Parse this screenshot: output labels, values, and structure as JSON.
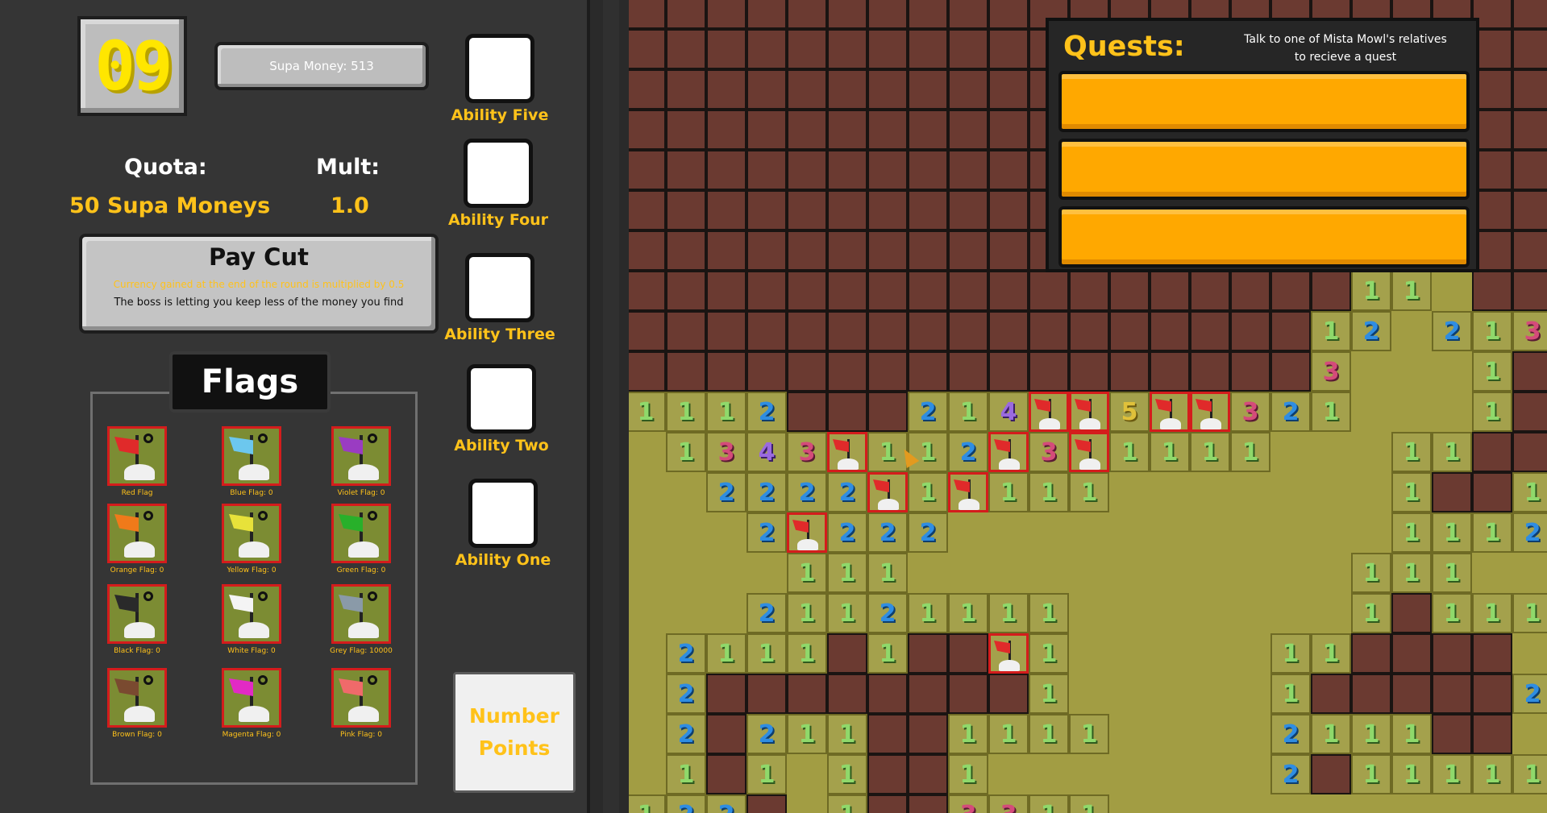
{
  "hud": {
    "level": "09",
    "money_label": "Supa Money: 513",
    "quota_label": "Quota:",
    "quota_value": "50 Supa Moneys",
    "mult_label": "Mult:",
    "mult_value": "1.0"
  },
  "modifier": {
    "title": "Pay Cut",
    "description": "Currency gained at the end of the round is multiplied by 0.5",
    "flavor": "The boss is letting you keep less of the money you find"
  },
  "flags": {
    "title": "Flags",
    "items": [
      {
        "label": "Red Flag",
        "color": "#e02a2a"
      },
      {
        "label": "Blue Flag: 0",
        "color": "#6cc7ee"
      },
      {
        "label": "Violet Flag: 0",
        "color": "#9a3cc2"
      },
      {
        "label": "Orange Flag: 0",
        "color": "#f07a1a"
      },
      {
        "label": "Yellow Flag: 0",
        "color": "#e7e23a"
      },
      {
        "label": "Green Flag: 0",
        "color": "#28b02a"
      },
      {
        "label": "Black Flag: 0",
        "color": "#2a2a2a"
      },
      {
        "label": "White Flag: 0",
        "color": "#f4f4f4"
      },
      {
        "label": "Grey Flag: 10000",
        "color": "#8a9aa8"
      },
      {
        "label": "Brown Flag: 0",
        "color": "#7a4a30"
      },
      {
        "label": "Magenta Flag: 0",
        "color": "#e22ac4"
      },
      {
        "label": "Pink Flag: 0",
        "color": "#f06a6a"
      }
    ]
  },
  "abilities": {
    "five": "Ability Five",
    "four": "Ability Four",
    "three": "Ability Three",
    "two": "Ability Two",
    "one": "Ability One"
  },
  "number_points": {
    "line1": "Number",
    "line2": "Points"
  },
  "quests": {
    "title": "Quests:",
    "hint_line1": "Talk to one of Mista Mowl's relatives",
    "hint_line2": "to recieve a quest"
  },
  "board_tiles": [
    "1",
    "1",
    "1",
    "2",
    "2",
    "1",
    "3",
    "3",
    "1",
    "1",
    "1",
    "1",
    "2",
    "2",
    "1",
    "4",
    "5",
    "3",
    "2",
    "1",
    "1",
    "1",
    "3",
    "4",
    "3",
    "1",
    "1",
    "2",
    "3",
    "1",
    "1",
    "1",
    "1",
    "1",
    "1",
    "2",
    "2",
    "2",
    "2",
    "1",
    "1",
    "1",
    "1",
    "1",
    "1",
    "2",
    "2",
    "2",
    "2",
    "1",
    "1",
    "1",
    "2",
    "1",
    "1",
    "1",
    "1",
    "1",
    "1",
    "2",
    "1",
    "1",
    "2",
    "1",
    "1",
    "1",
    "1",
    "1",
    "1",
    "1",
    "1",
    "2",
    "1",
    "1",
    "1",
    "1",
    "1",
    "1",
    "1",
    "2",
    "1",
    "1",
    "2",
    "2",
    "2",
    "1",
    "1",
    "1",
    "1",
    "1",
    "1",
    "2",
    "1",
    "1",
    "1",
    "1",
    "1",
    "1",
    "1",
    "2",
    "1",
    "1",
    "1"
  ],
  "colors": {
    "accent": "#ffc21a",
    "level": "#ffe600",
    "dirt": "#6b3a31",
    "grass": "#a29d43",
    "quest_slot": "#ffa800",
    "flag_border": "#d41c1c"
  }
}
